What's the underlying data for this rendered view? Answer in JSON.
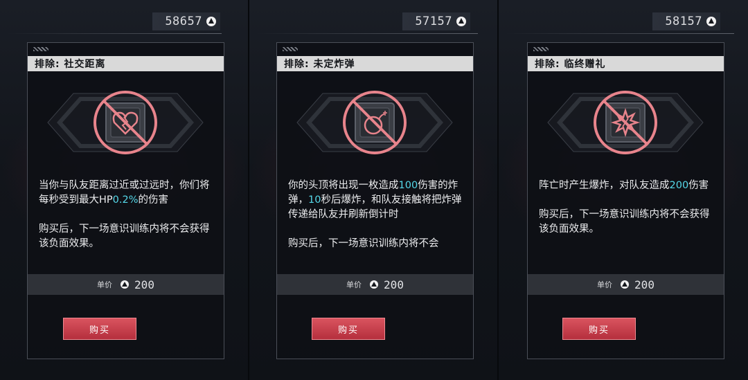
{
  "panels": [
    {
      "currency": "58657",
      "title": "排除: 社交距离",
      "icon": "heart-broken-icon",
      "description": [
        [
          {
            "t": "当你与队友距离过近或过远时，你们将每秒受到最大HP",
            "hl": false
          },
          {
            "t": "0.2%",
            "hl": true
          },
          {
            "t": "的伤害",
            "hl": false
          }
        ],
        [
          {
            "t": "购买后，下一场意识训练内将不会获得该负面效果。",
            "hl": false
          }
        ]
      ],
      "price_label": "单价",
      "price": "200",
      "buy_label": "购买"
    },
    {
      "currency": "57157",
      "title": "排除: 未定炸弹",
      "icon": "bomb-icon",
      "description": [
        [
          {
            "t": "你的头顶将出现一枚造成",
            "hl": false
          },
          {
            "t": "100",
            "hl": true
          },
          {
            "t": "伤害的炸弹，",
            "hl": false
          },
          {
            "t": "10",
            "hl": true
          },
          {
            "t": "秒后爆炸，和队友接触将把炸弹传递给队友并刷新倒计时",
            "hl": false
          }
        ],
        [
          {
            "t": "购买后，下一场意识训练内将不会",
            "hl": false
          }
        ]
      ],
      "price_label": "单价",
      "price": "200",
      "buy_label": "购买"
    },
    {
      "currency": "58157",
      "title": "排除: 临终赠礼",
      "icon": "explosion-icon",
      "description": [
        [
          {
            "t": "阵亡时产生爆炸，对队友造成",
            "hl": false
          },
          {
            "t": "200",
            "hl": true
          },
          {
            "t": "伤害",
            "hl": false
          }
        ],
        [
          {
            "t": "购买后，下一场意识训练内将不会获得该负面效果。",
            "hl": false
          }
        ]
      ],
      "price_label": "单价",
      "price": "200",
      "buy_label": "购买"
    }
  ],
  "colors": {
    "accent_red": "#c8404c",
    "highlight_cyan": "#56d9ea",
    "header_bg": "#d9d9d9",
    "forbidden_red": "#e8848c"
  }
}
